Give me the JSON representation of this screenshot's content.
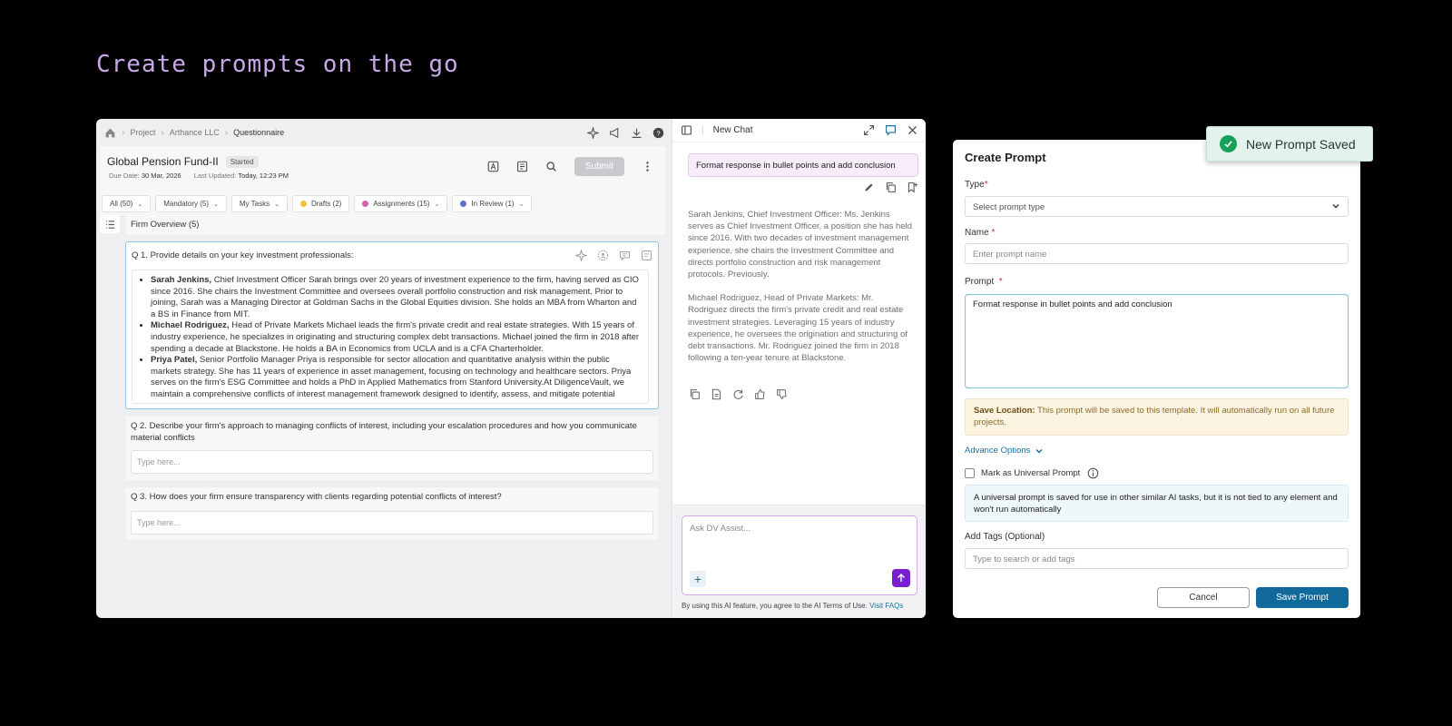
{
  "headline": "Create prompts on the go",
  "breadcrumb": {
    "items": [
      "Project",
      "Arthance LLC",
      "Questionnaire"
    ]
  },
  "fund": {
    "title": "Global Pension Fund-II",
    "status": "Started",
    "due_label": "Due Date:",
    "due_value": "30 Mar, 2026",
    "updated_label": "Last Updated:",
    "updated_value": "Today, 12:23 PM",
    "submit_label": "Submit"
  },
  "filters": [
    {
      "label": "All (50)",
      "dot": ""
    },
    {
      "label": "Mandatory (5)",
      "dot": ""
    },
    {
      "label": "My Tasks",
      "dot": ""
    },
    {
      "label": "Drafts (2)",
      "dot": "#f0c23a"
    },
    {
      "label": "Assignments (15)",
      "dot": "#d45fb0"
    },
    {
      "label": "In Review (1)",
      "dot": "#5b6fd1"
    }
  ],
  "section": {
    "title": "Firm Overview (5)"
  },
  "questions": {
    "q1": "Q 1. Provide details on your key investment professionals:",
    "q1_answers": [
      {
        "name": "Sarah Jenkins,",
        "text": " Chief Investment Officer Sarah brings over 20 years of investment experience to the firm, having served as CIO since 2016. She chairs the Investment Committee and oversees overall portfolio construction and risk management. Prior to joining, Sarah was a Managing Director at Goldman Sachs in the Global Equities division. She holds an MBA from Wharton and a BS in Finance from MIT."
      },
      {
        "name": "Michael Rodriguez,",
        "text": " Head of Private Markets Michael leads the firm's private credit and real estate strategies. With 15 years of industry experience, he specializes in originating and structuring complex debt transactions. Michael joined the firm in 2018 after spending a decade at Blackstone. He holds a BA in Economics from UCLA and is a CFA Charterholder."
      },
      {
        "name": "Priya Patel,",
        "text": " Senior Portfolio Manager Priya is responsible for sector allocation and quantitative analysis within the public markets strategy. She has 11 years of experience in asset management, focusing on technology and healthcare sectors. Priya serves on the firm's ESG Committee and holds a PhD in Applied Mathematics from Stanford University.At DiligenceVault, we maintain a comprehensive conflicts of interest management framework designed to identify, assess, and mitigate potential"
      }
    ],
    "q2": "Q 2. Describe your firm's approach to managing conflicts of interest, including your escalation procedures and how you communicate material conflicts",
    "q3": "Q 3. How does your firm ensure transparency with clients regarding potential conflicts of interest?",
    "placeholder": "Type here..."
  },
  "chat": {
    "title": "New Chat",
    "user_message": "Format response in bullet points and add conclusion",
    "ai_paragraphs": [
      "Sarah Jenkins, Chief Investment Officer: Ms. Jenkins serves as Chief Investment Officer, a position she has held since 2016. With two decades of investment management experience, she chairs the Investment Committee and directs portfolio construction and risk management protocols. Previously.",
      "Michael Rodriguez, Head of Private Markets: Mr. Rodriguez directs the firm's private credit and real estate investment strategies. Leveraging 15 years of industry experience, he oversees the origination and structuring of debt transactions. Mr. Rodriguez joined the firm in 2018 following a ten-year tenure at Blackstone."
    ],
    "input_placeholder": "Ask DV Assist...",
    "terms_text": "By using this AI feature, you agree to the AI Terms of Use.",
    "terms_link": "Visit FAQs"
  },
  "create_prompt": {
    "title": "Create Prompt",
    "type_label": "Type",
    "type_placeholder": "Select prompt type",
    "name_label": "Name",
    "name_placeholder": "Enter prompt name",
    "prompt_label": "Prompt",
    "prompt_value": "Format response in bullet points and add conclusion",
    "save_location_label": "Save Location:",
    "save_location_text": " This prompt will be saved to this template. It will automatically run on all future projects.",
    "advance_options": "Advance Options",
    "universal_label": "Mark as Universal Prompt",
    "universal_info": "A universal prompt is saved for use in other similar AI tasks, but it is not tied to any element and won't run automatically",
    "tags_label": "Add Tags (Optional)",
    "tags_placeholder": "Type to search or add tags",
    "cancel_label": "Cancel",
    "save_label": "Save Prompt"
  },
  "toast": {
    "message": "New Prompt Saved"
  },
  "colors": {
    "accent": "#12699c",
    "chat_send": "#7a1fd0",
    "success": "#17a058",
    "headline": "#c9a8e8"
  }
}
